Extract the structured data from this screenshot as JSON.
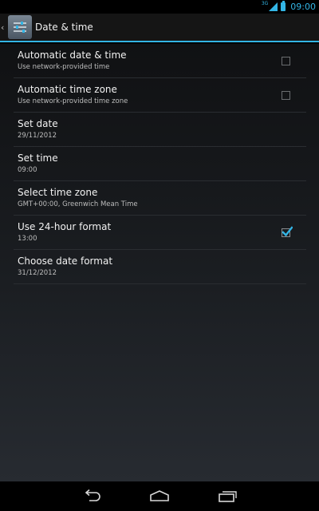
{
  "status_bar": {
    "network_type": "3G",
    "time": "09:00"
  },
  "action_bar": {
    "title": "Date & time"
  },
  "settings": [
    {
      "title": "Automatic date & time",
      "summary": "Use network-provided time",
      "checkbox": true,
      "checked": false
    },
    {
      "title": "Automatic time zone",
      "summary": "Use network-provided time zone",
      "checkbox": true,
      "checked": false
    },
    {
      "title": "Set date",
      "summary": "29/11/2012",
      "checkbox": false
    },
    {
      "title": "Set time",
      "summary": "09:00",
      "checkbox": false
    },
    {
      "title": "Select time zone",
      "summary": "GMT+00:00, Greenwich Mean Time",
      "checkbox": false
    },
    {
      "title": "Use 24-hour format",
      "summary": "13:00",
      "checkbox": true,
      "checked": true
    },
    {
      "title": "Choose date format",
      "summary": "31/12/2012",
      "checkbox": false
    }
  ],
  "colors": {
    "accent": "#33b5e5",
    "background": "#101113",
    "text_primary": "#f2f2f2",
    "text_secondary": "#bdbdbd"
  },
  "icons": {
    "status": [
      "signal-icon",
      "battery-icon"
    ],
    "action_bar": [
      "up-caret-icon",
      "settings-sliders-icon"
    ],
    "nav": [
      "back-icon",
      "home-icon",
      "recent-apps-icon"
    ]
  }
}
